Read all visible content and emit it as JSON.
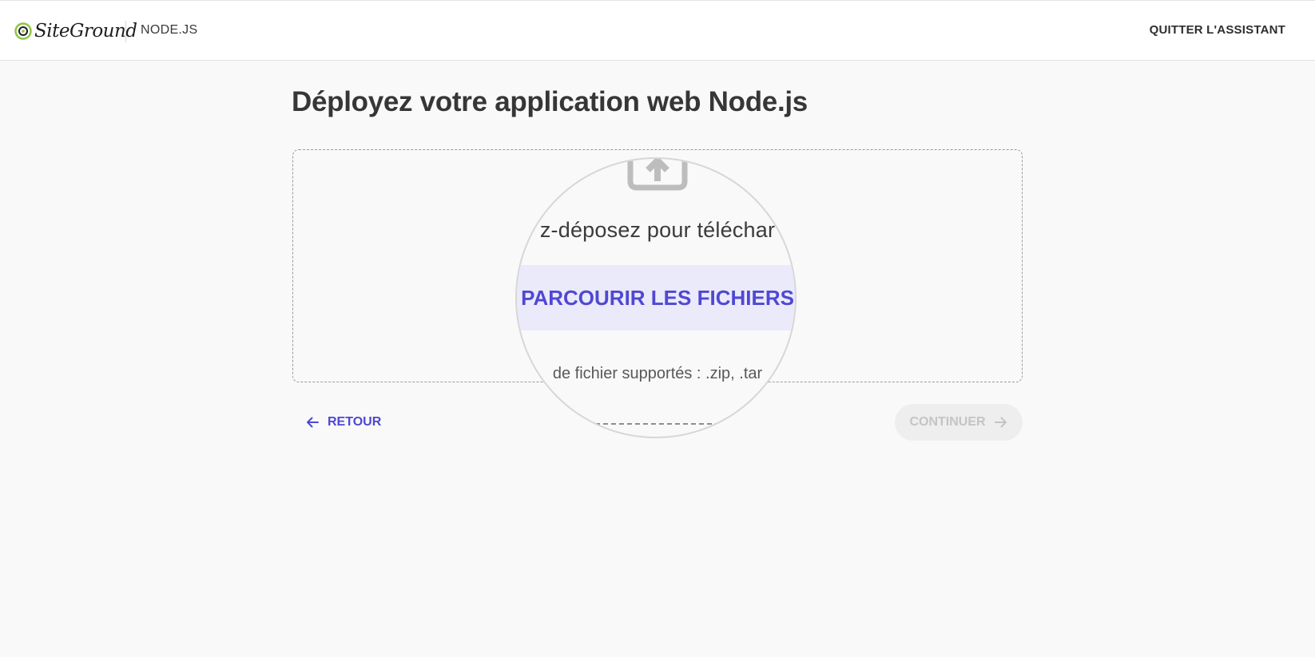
{
  "header": {
    "brand": "SiteGround",
    "app_name": "NODE.JS",
    "quit_label": "QUITTER L'ASSISTANT"
  },
  "page": {
    "title": "Déployez votre application web Node.js"
  },
  "dropzone": {
    "hint": "z-déposez pour téléchar",
    "browse_label": "PARCOURIR LES FICHIERS",
    "formats": "de fichier supportés : .zip, .tar"
  },
  "nav": {
    "back_label": "RETOUR",
    "continue_label": "CONTINUER"
  },
  "colors": {
    "accent": "#4e47d2",
    "brand_green": "#8cc63f",
    "disabled_bg": "#eeeeee",
    "disabled_text": "#c4c4c4"
  },
  "icons": {
    "logo": "siteground-logo-icon",
    "upload": "upload-icon",
    "back": "arrow-left-icon",
    "continue": "arrow-right-icon"
  }
}
